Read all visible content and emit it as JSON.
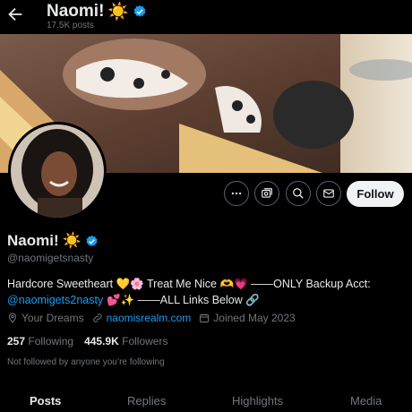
{
  "topbar": {
    "name": "Naomi!",
    "name_emoji": "☀️",
    "posts_count": "17.5K posts"
  },
  "profile": {
    "name": "Naomi!",
    "name_emoji": "☀️",
    "handle": "@naomigetsnasty",
    "bio_line1_prefix": "Hardcore Sweetheart ",
    "bio_line1_emoji1": "💛🌸",
    "bio_line1_mid": " Treat Me Nice ",
    "bio_line1_emoji2": "🫶💗",
    "bio_line1_suffix": " ——ONLY Backup Acct:",
    "bio_mention": "@naomigets2nasty",
    "bio_line2_emoji": " 💕✨",
    "bio_line2_suffix": " ——ALL Links Below ",
    "bio_line2_emoji2": "🔗",
    "location": "Your Dreams",
    "website": "naomisrealm.com",
    "joined": "Joined May 2023",
    "following_count": "257",
    "following_label": "Following",
    "followers_count": "445.9K",
    "followers_label": "Followers",
    "not_followed": "Not followed by anyone you’re following"
  },
  "actions": {
    "follow_label": "Follow"
  },
  "tabs": [
    {
      "label": "Posts"
    },
    {
      "label": "Replies"
    },
    {
      "label": "Highlights"
    },
    {
      "label": "Media"
    }
  ],
  "colors": {
    "accent": "#1d9bf0",
    "background": "#000000",
    "muted": "#71767b"
  }
}
